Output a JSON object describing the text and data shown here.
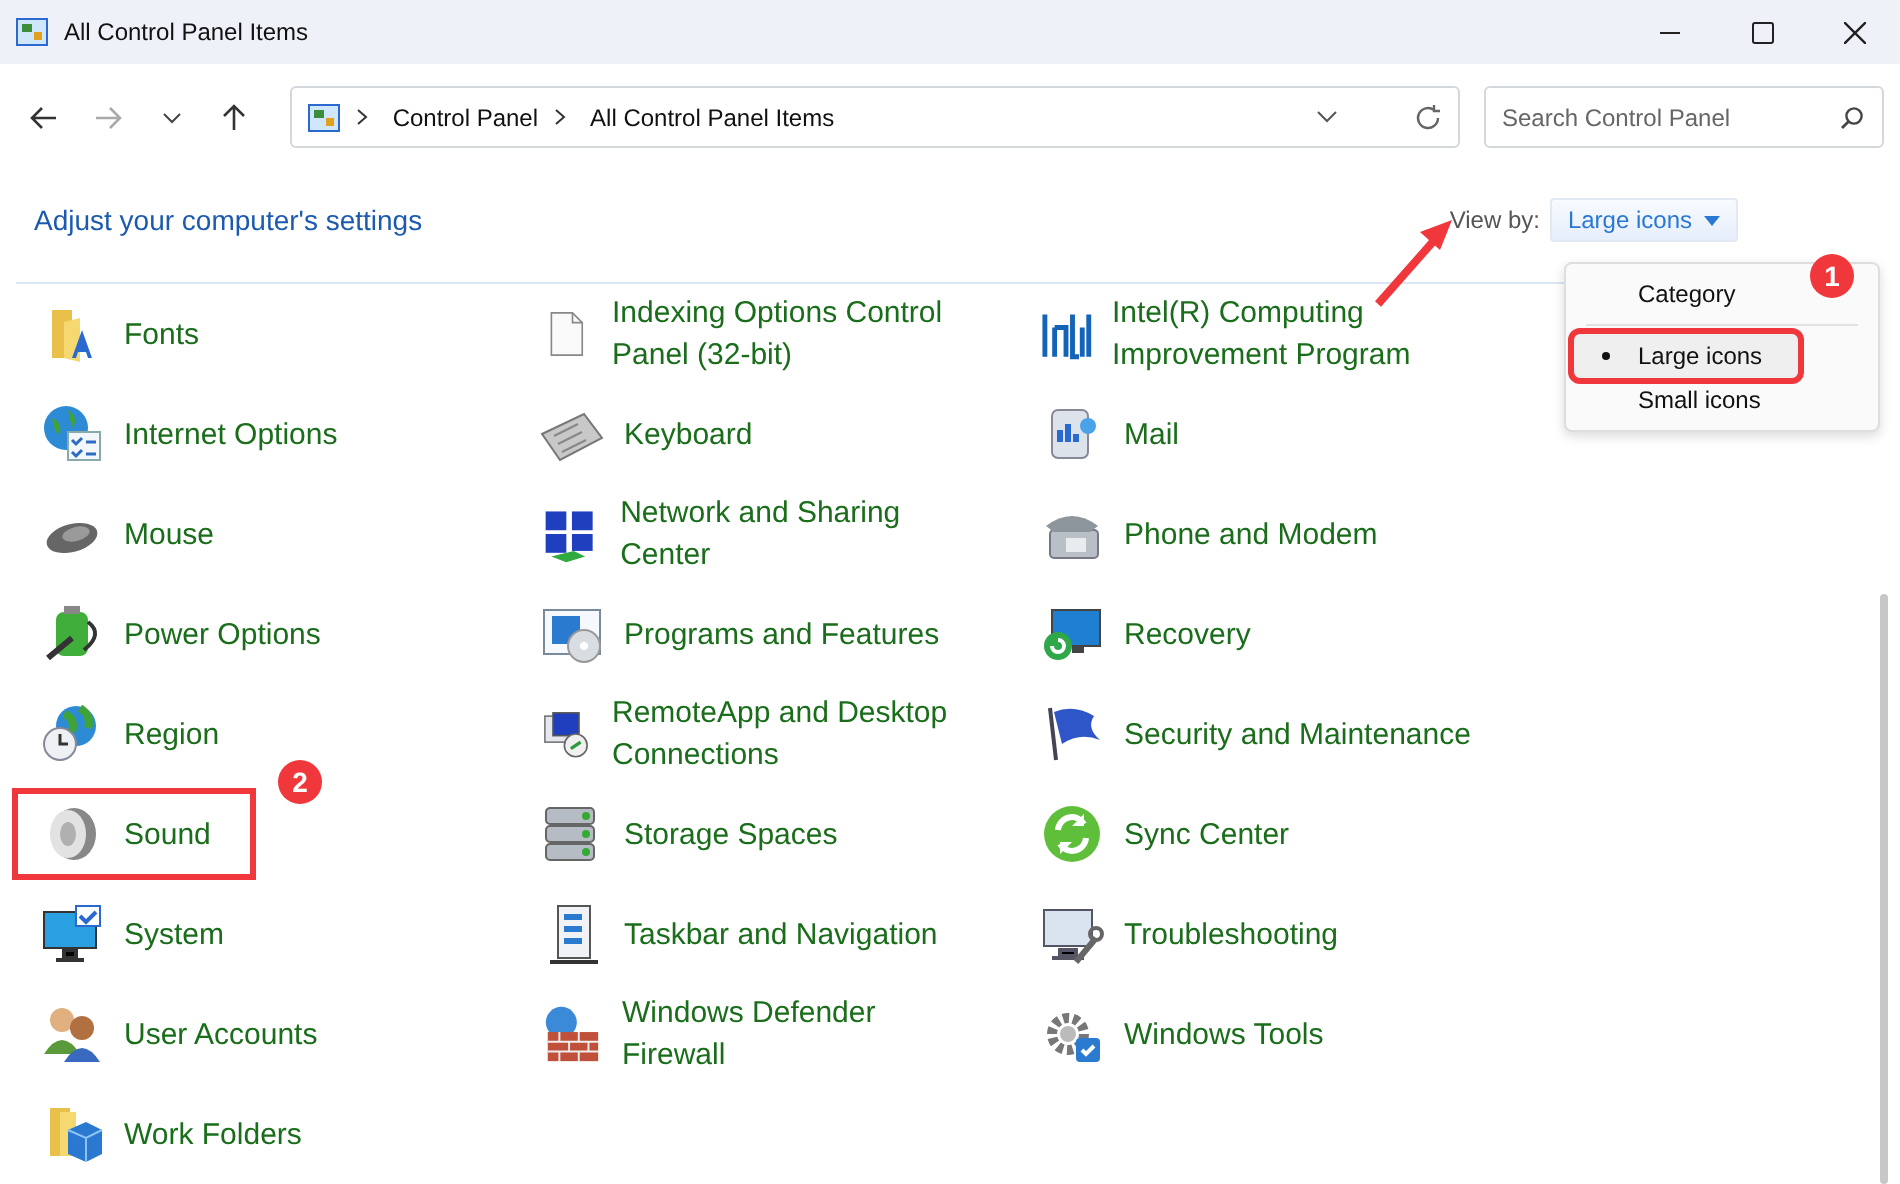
{
  "window": {
    "title": "All Control Panel Items"
  },
  "nav": {
    "back_disabled": false,
    "forward_disabled": true
  },
  "address": {
    "crumbs": [
      "Control Panel",
      "All Control Panel Items"
    ]
  },
  "search": {
    "placeholder": "Search Control Panel"
  },
  "header": {
    "title": "Adjust your computer's settings"
  },
  "view_by": {
    "label": "View by:",
    "value": "Large icons",
    "arrow": true
  },
  "view_menu": {
    "badge": "1",
    "items": [
      {
        "label": "Category",
        "selected": false,
        "highlighted": false
      },
      {
        "label": "Large icons",
        "selected": true,
        "highlighted": true
      },
      {
        "label": "Small icons",
        "selected": false,
        "highlighted": false
      }
    ]
  },
  "items": [
    {
      "label": "Fonts"
    },
    {
      "label": "Indexing Options Control Panel (32-bit)"
    },
    {
      "label": "Intel(R) Computing Improvement Program"
    },
    {
      "label": "Internet Options"
    },
    {
      "label": "Keyboard"
    },
    {
      "label": "Mail"
    },
    {
      "label": "Mouse"
    },
    {
      "label": "Network and Sharing Center"
    },
    {
      "label": "Phone and Modem"
    },
    {
      "label": "Power Options"
    },
    {
      "label": "Programs and Features"
    },
    {
      "label": "Recovery"
    },
    {
      "label": "Region"
    },
    {
      "label": "RemoteApp and Desktop Connections"
    },
    {
      "label": "Security and Maintenance"
    },
    {
      "label": "Sound",
      "highlighted": true,
      "badge": "2"
    },
    {
      "label": "Storage Spaces"
    },
    {
      "label": "Sync Center"
    },
    {
      "label": "System"
    },
    {
      "label": "Taskbar and Navigation"
    },
    {
      "label": "Troubleshooting"
    },
    {
      "label": "User Accounts"
    },
    {
      "label": "Windows Defender Firewall"
    },
    {
      "label": "Windows Tools"
    },
    {
      "label": "Work Folders"
    }
  ]
}
